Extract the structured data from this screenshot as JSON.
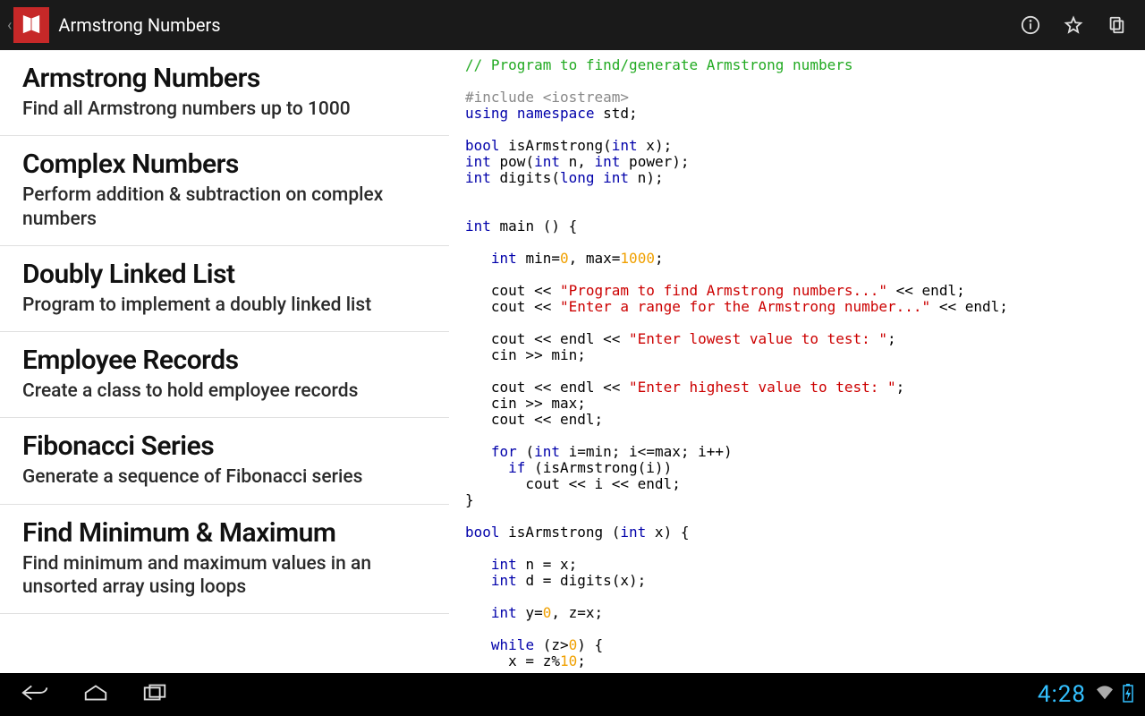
{
  "header": {
    "title": "Armstrong Numbers"
  },
  "list": [
    {
      "title": "Armstrong Numbers",
      "sub": "Find all Armstrong numbers up to 1000"
    },
    {
      "title": "Complex Numbers",
      "sub": "Perform addition & subtraction on complex numbers"
    },
    {
      "title": "Doubly Linked List",
      "sub": "Program to implement a doubly linked list"
    },
    {
      "title": "Employee Records",
      "sub": "Create a class to hold employee records"
    },
    {
      "title": "Fibonacci Series",
      "sub": "Generate a sequence of Fibonacci series"
    },
    {
      "title": "Find Minimum & Maximum",
      "sub": "Find minimum and maximum values in an unsorted array using loops"
    }
  ],
  "code": {
    "comment1": "// Program to find/generate Armstrong numbers",
    "include": "#include <iostream>",
    "str1": "\"Program to find Armstrong numbers...\"",
    "str2": "\"Enter a range for the Armstrong number...\"",
    "str3": "\"Enter lowest value to test: \"",
    "str4": "\"Enter highest value to test: \"",
    "n0": "0",
    "n1000": "1000",
    "n10": "10"
  },
  "status": {
    "time": "4:28"
  }
}
